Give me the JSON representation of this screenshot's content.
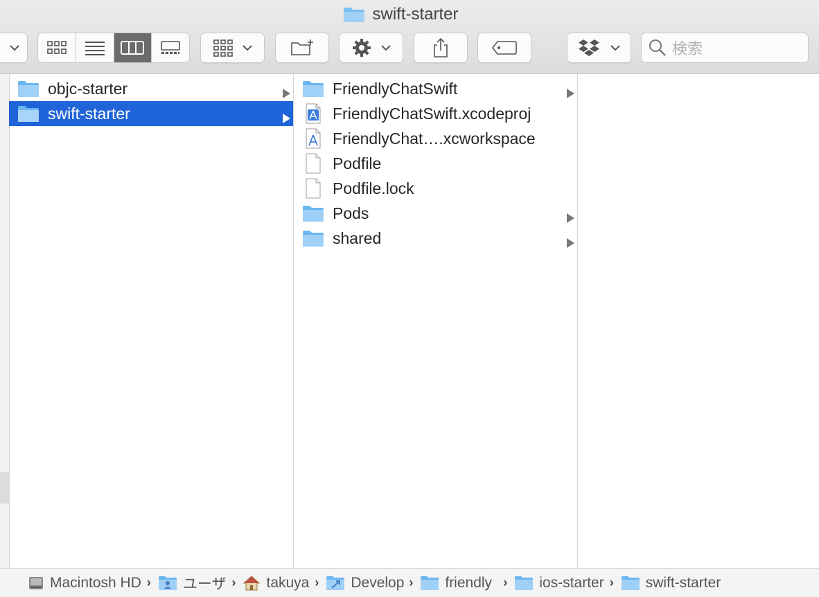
{
  "window": {
    "title": "swift-starter"
  },
  "toolbar": {
    "search_placeholder": "検索",
    "view_buttons": [
      "icon-view",
      "list-view",
      "column-view",
      "gallery-view"
    ],
    "active_view": "column-view"
  },
  "columns": {
    "first": [
      {
        "name": "objc-starter",
        "type": "folder",
        "has_children": true,
        "selected": false
      },
      {
        "name": "swift-starter",
        "type": "folder",
        "has_children": true,
        "selected": true
      }
    ],
    "second": [
      {
        "name": "FriendlyChatSwift",
        "type": "folder",
        "has_children": true
      },
      {
        "name": "FriendlyChatSwift.xcodeproj",
        "type": "xcode"
      },
      {
        "name": "FriendlyChat….xcworkspace",
        "type": "xcode"
      },
      {
        "name": "Podfile",
        "type": "document"
      },
      {
        "name": "Podfile.lock",
        "type": "document"
      },
      {
        "name": "Pods",
        "type": "folder",
        "has_children": true
      },
      {
        "name": "shared",
        "type": "folder",
        "has_children": true
      }
    ]
  },
  "pathbar": {
    "items": [
      {
        "label": "Macintosh HD",
        "icon": "hard-drive-icon"
      },
      {
        "label": "ユーザ",
        "icon": "users-folder-icon"
      },
      {
        "label": "takuya",
        "icon": "home-icon"
      },
      {
        "label": "Develop",
        "icon": "developer-folder-icon"
      },
      {
        "label": "friendly",
        "icon": "folder-icon"
      },
      {
        "label": "ios-starter",
        "icon": "folder-icon"
      },
      {
        "label": "swift-starter",
        "icon": "folder-icon"
      }
    ]
  },
  "colors": {
    "selection": "#2064d9",
    "folder": "#6cb6f0"
  }
}
